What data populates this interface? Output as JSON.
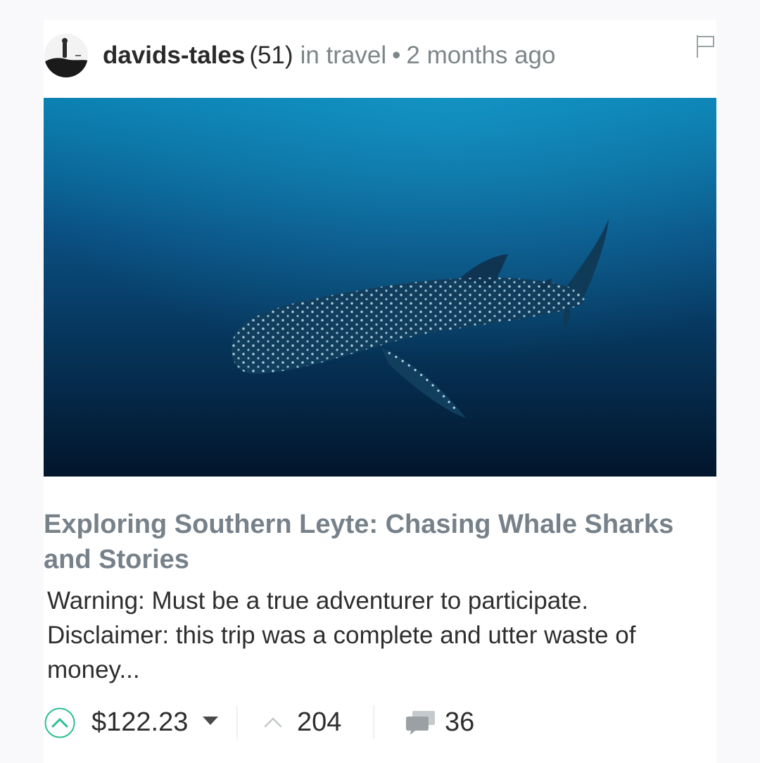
{
  "post": {
    "author": "davids-tales",
    "reputation": "(51)",
    "category": "in travel",
    "separator": "•",
    "time_ago": "2 months ago",
    "title": "Exploring Southern Leyte: Chasing Whale Sharks and Stories",
    "excerpt": "Warning: Must be a true adventurer to participate. Disclaimer: this trip was a complete and utter waste of money..."
  },
  "footer": {
    "payout": "$122.23",
    "votes": "204",
    "comments": "36"
  },
  "icons": {
    "avatar": "avatar",
    "flag": "flag-icon",
    "upvote": "upvote-circle-icon",
    "payout_dropdown": "chevron-down-icon",
    "votes": "chevron-up-icon",
    "comments": "comments-icon"
  },
  "colors": {
    "accent_green": "#2bbf93",
    "title_grey": "#77818a",
    "meta_grey": "#7c8588",
    "text_dark": "#2e2e2e",
    "ocean_top": "#0a7fb0",
    "ocean_bottom": "#02152b"
  }
}
